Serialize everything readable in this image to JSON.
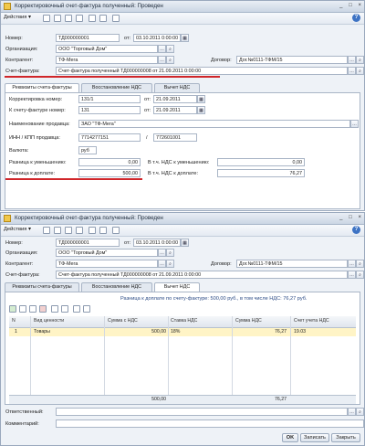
{
  "window1": {
    "title": "Корректировочный счет-фактура полученный: Проведен",
    "win_buttons": [
      "_",
      "□",
      "×"
    ],
    "actions_label": "Действия ▾",
    "number_label": "Номер:",
    "number_value": "ТД000000001",
    "from_label": "от:",
    "date_value": "03.10.2011  0:00:00",
    "org_label": "Организация:",
    "org_value": "ООО \"Торговый Дом\"",
    "contractor_label": "Контрагент:",
    "contractor_value": "ТФ-Мега",
    "contract_label": "Договор:",
    "contract_value": "Дог.№0111-ТФМ/15",
    "invoice_label": "Счет-фактура:",
    "invoice_value": "Счет-фактура полученный ТД000000008 от 21.09.2011 0:00:00",
    "tabs": [
      "Реквизиты счета-фактуры",
      "Восстановление НДС",
      "Вычет НДС"
    ],
    "req": {
      "corr_number_label": "Корректировка номер:",
      "corr_number_value": "131/1",
      "corr_from_label": "от:",
      "corr_date_value": "21.09.2011",
      "to_invoice_label": "К счету-фактуре номер:",
      "to_invoice_value": "131",
      "to_from_label": "от:",
      "to_date_value": "21.09.2011",
      "seller_label": "Наименование продавца:",
      "seller_value": "ЗАО \"ТФ-Мега\"",
      "inn_label": "ИНН / КПП продавца:",
      "inn_value": "7714277151",
      "kpp_sep": "/",
      "kpp_value": "772601001",
      "currency_label": "Валюта:",
      "currency_value": "руб",
      "decrease_label": "Разница к уменьшению:",
      "decrease_value": "0,00",
      "decrease_vat_label": "В т.ч. НДС к уменьшению:",
      "decrease_vat_value": "0,00",
      "surcharge_label": "Разница к доплате:",
      "surcharge_value": "500,00",
      "surcharge_vat_label": "В т.ч. НДС к доплате:",
      "surcharge_vat_value": "76,27"
    }
  },
  "window2": {
    "title": "Корректировочный счет-фактура полученный: Проведен",
    "win_buttons": [
      "_",
      "□",
      "×"
    ],
    "actions_label": "Действия ▾",
    "number_label": "Номер:",
    "number_value": "ТД000000001",
    "from_label": "от:",
    "date_value": "03.10.2011  0:00:00",
    "org_label": "Организация:",
    "org_value": "ООО \"Торговый Дом\"",
    "contractor_label": "Контрагент:",
    "contractor_value": "ТФ-Мега",
    "contract_label": "Договор:",
    "contract_value": "Дог.№0111-ТФМ/15",
    "invoice_label": "Счет-фактура:",
    "invoice_value": "Счет-фактура полученный ТД000000008 от 21.09.2011 0:00:00",
    "tabs": [
      "Реквизиты счета-фактуры",
      "Восстановление НДС",
      "Вычет НДС"
    ],
    "deduction_note": "Разница к доплате по счету-фактуре: 500,00 руб., в том числе НДС: 76,27 руб.",
    "grid": {
      "columns": [
        "N",
        "Вид ценности",
        "Сумма с НДС",
        "Ставка НДС",
        "Сумма НДС",
        "Счет учета НДС"
      ],
      "rows": [
        {
          "n": "1",
          "kind": "Товары",
          "sum": "500,00",
          "rate": "18%",
          "vat": "76,27",
          "account": "19.03"
        }
      ],
      "footer_sum": "500,00",
      "footer_vat": "76,27"
    },
    "responsible_label": "Ответственный:",
    "comment_label": "Комментарий:",
    "buttons": {
      "ok": "OK",
      "save": "Записать",
      "close": "Закрыть"
    }
  },
  "colors": {
    "highlight": "#d0262a",
    "selected_row": "#fff4c6",
    "window_bg": "#eef2f7"
  }
}
